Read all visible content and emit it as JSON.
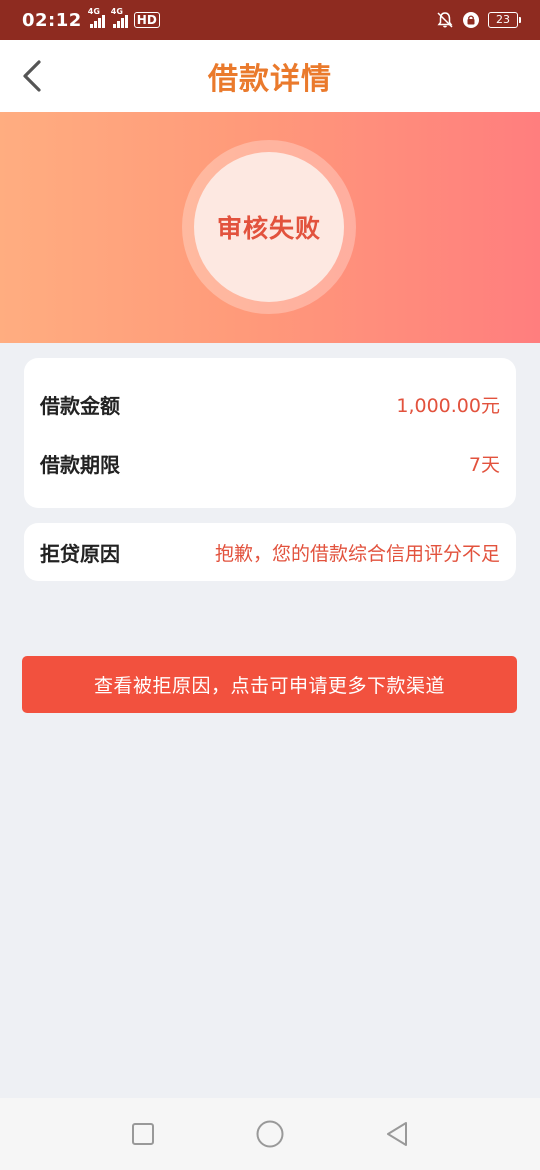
{
  "status_bar": {
    "time": "02:12",
    "network1": "4G",
    "network2": "4G",
    "hd": "HD",
    "battery": "23"
  },
  "nav": {
    "title": "借款详情"
  },
  "hero": {
    "status": "审核失败"
  },
  "loan_info": {
    "rows": [
      {
        "label": "借款金额",
        "value": "1,000.00元"
      },
      {
        "label": "借款期限",
        "value": "7天"
      }
    ]
  },
  "reason": {
    "label": "拒贷原因",
    "value": "抱歉，您的借款综合信用评分不足"
  },
  "cta": {
    "label": "查看被拒原因，点击可申请更多下款渠道"
  },
  "colors": {
    "accent": "#ea7a2c",
    "danger": "#e2523d",
    "button": "#f2513e",
    "status_bar": "#8e2b20"
  }
}
